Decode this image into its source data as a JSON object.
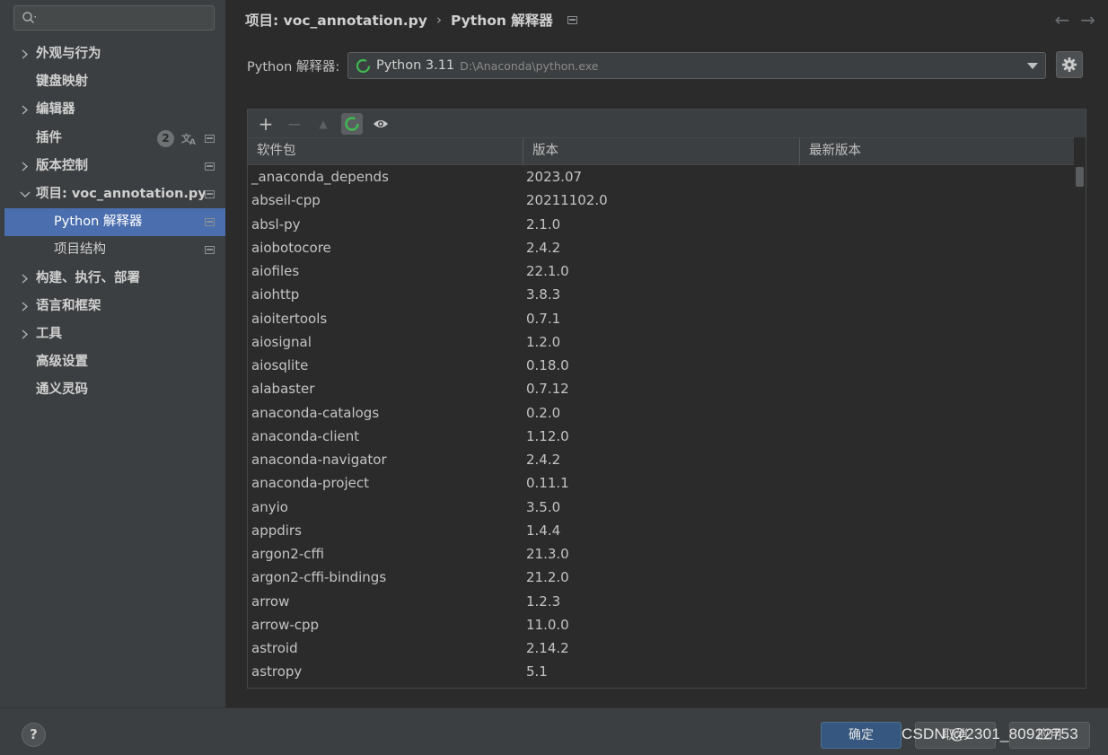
{
  "sidebar": {
    "search_placeholder": "",
    "items": [
      {
        "label": "外观与行为",
        "expandable": true
      },
      {
        "label": "键盘映射"
      },
      {
        "label": "编辑器",
        "expandable": true
      },
      {
        "label": "插件",
        "badge": "2"
      },
      {
        "label": "版本控制",
        "expandable": true
      },
      {
        "label": "项目: voc_annotation.py",
        "expanded": true
      },
      {
        "label": "Python 解释器",
        "selected": true
      },
      {
        "label": "项目结构"
      },
      {
        "label": "构建、执行、部署",
        "expandable": true
      },
      {
        "label": "语言和框架",
        "expandable": true
      },
      {
        "label": "工具",
        "expandable": true
      },
      {
        "label": "高级设置"
      },
      {
        "label": "通义灵码"
      }
    ]
  },
  "header": {
    "crumb_project": "项目: voc_annotation.py",
    "crumb_separator": "›",
    "crumb_page": "Python 解释器",
    "back_arrow": "←",
    "forward_arrow": "→"
  },
  "interpreter": {
    "label": "Python 解释器:",
    "name": "Python 3.11",
    "path": "D:\\Anaconda\\python.exe"
  },
  "toolbar": {
    "add": "+",
    "remove": "−",
    "upgrade": "▲",
    "show": "👁"
  },
  "table": {
    "headers": [
      "软件包",
      "版本",
      "最新版本"
    ],
    "rows": [
      [
        "_anaconda_depends",
        "2023.07",
        ""
      ],
      [
        "abseil-cpp",
        "20211102.0",
        ""
      ],
      [
        "absl-py",
        "2.1.0",
        ""
      ],
      [
        "aiobotocore",
        "2.4.2",
        ""
      ],
      [
        "aiofiles",
        "22.1.0",
        ""
      ],
      [
        "aiohttp",
        "3.8.3",
        ""
      ],
      [
        "aioitertools",
        "0.7.1",
        ""
      ],
      [
        "aiosignal",
        "1.2.0",
        ""
      ],
      [
        "aiosqlite",
        "0.18.0",
        ""
      ],
      [
        "alabaster",
        "0.7.12",
        ""
      ],
      [
        "anaconda-catalogs",
        "0.2.0",
        ""
      ],
      [
        "anaconda-client",
        "1.12.0",
        ""
      ],
      [
        "anaconda-navigator",
        "2.4.2",
        ""
      ],
      [
        "anaconda-project",
        "0.11.1",
        ""
      ],
      [
        "anyio",
        "3.5.0",
        ""
      ],
      [
        "appdirs",
        "1.4.4",
        ""
      ],
      [
        "argon2-cffi",
        "21.3.0",
        ""
      ],
      [
        "argon2-cffi-bindings",
        "21.2.0",
        ""
      ],
      [
        "arrow",
        "1.2.3",
        ""
      ],
      [
        "arrow-cpp",
        "11.0.0",
        ""
      ],
      [
        "astroid",
        "2.14.2",
        ""
      ],
      [
        "astropy",
        "5.1",
        ""
      ]
    ]
  },
  "footer": {
    "help": "?",
    "ok": "确定",
    "cancel": "取消",
    "apply": "应用"
  },
  "watermark": "CSDN @2301_80922753",
  "colors": {
    "sidebar_bg": "#3c3f41",
    "selected_bg": "#4b6eaf",
    "main_bg": "#2b2b2b",
    "ok_button": "#365880",
    "spinner": "#3fb950"
  }
}
